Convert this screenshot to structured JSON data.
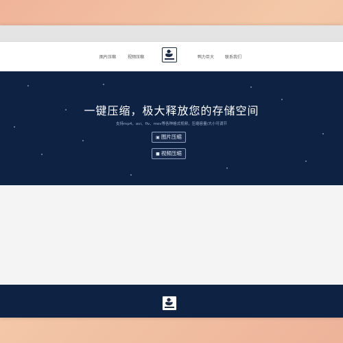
{
  "nav": {
    "left_links": [
      "图片压缩",
      "视频压缩"
    ],
    "right_links": [
      "鸭力巨大",
      "联系我们"
    ]
  },
  "hero": {
    "title": "一键压缩，极大释放您的存储空间",
    "subtitle": "支持mp4、avi、flv、mov等各种格式视频，压缩容量/大小可调节",
    "buttons": [
      {
        "icon": "image-icon",
        "label": "图片压缩"
      },
      {
        "icon": "video-icon",
        "label": "视频压缩"
      }
    ]
  },
  "colors": {
    "hero_bg": "#0e2244",
    "footer_bg": "#0e2244",
    "navbar_bg": "#ffffff",
    "outer_bg": "#f0b49a"
  }
}
